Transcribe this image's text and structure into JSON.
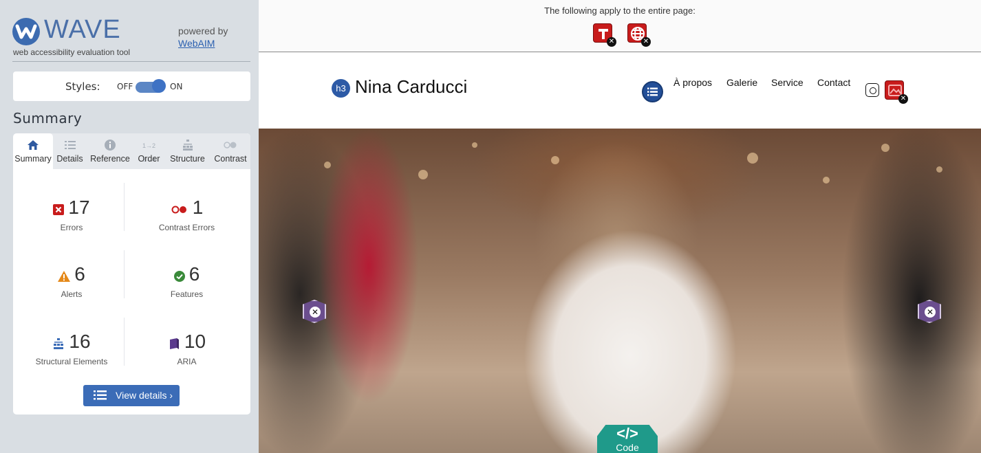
{
  "sidebar": {
    "logo_text": "WAVE",
    "logo_subtitle": "web accessibility evaluation tool",
    "powered_by": "powered by",
    "powered_link": "WebAIM",
    "styles_label": "Styles:",
    "styles_off": "OFF",
    "styles_on": "ON",
    "summary_heading": "Summary",
    "tabs": [
      {
        "label": "Summary",
        "icon": "home-icon",
        "active": true
      },
      {
        "label": "Details",
        "icon": "list-icon",
        "active": false
      },
      {
        "label": "Reference",
        "icon": "info-icon",
        "active": false
      },
      {
        "label": "Order",
        "icon": "order-icon",
        "active": false
      },
      {
        "label": "Structure",
        "icon": "structure-icon",
        "active": false
      },
      {
        "label": "Contrast",
        "icon": "contrast-icon",
        "active": false
      }
    ],
    "stats": {
      "errors": {
        "count": "17",
        "label": "Errors"
      },
      "contrast_errors": {
        "count": "1",
        "label": "Contrast Errors"
      },
      "alerts": {
        "count": "6",
        "label": "Alerts"
      },
      "features": {
        "count": "6",
        "label": "Features"
      },
      "structural": {
        "count": "16",
        "label": "Structural Elements"
      },
      "aria": {
        "count": "10",
        "label": "ARIA"
      }
    },
    "view_details": "View details ›"
  },
  "page": {
    "apply_text": "The following apply to the entire page:",
    "h3_badge": "h3",
    "site_title": "Nina Carducci",
    "nav": [
      "À propos",
      "Galerie",
      "Service",
      "Contact"
    ],
    "code_tab": {
      "icon": "</>",
      "label": "Code"
    }
  },
  "colors": {
    "brand": "#3c6bb0",
    "error": "#c81c1c",
    "alert": "#e5891a",
    "feature": "#3a8a3a",
    "aria": "#5b3a8e",
    "code_tab": "#1f9a8a"
  }
}
